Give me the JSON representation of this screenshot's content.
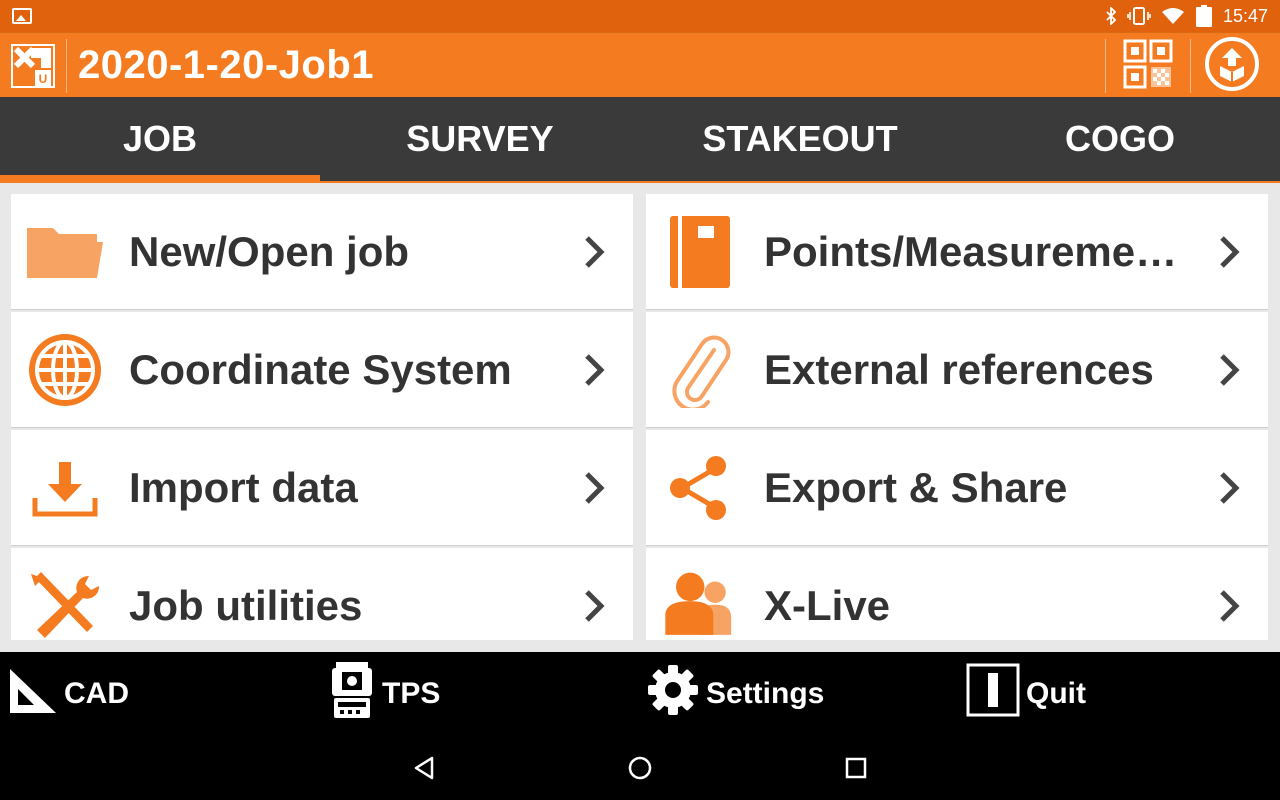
{
  "status_bar": {
    "time": "15:47",
    "icons": [
      "image-notification-icon",
      "bluetooth-icon",
      "vibrate-icon",
      "wifi-icon",
      "battery-icon"
    ]
  },
  "app_bar": {
    "title": "2020-1-20-Job1",
    "logo": "x-pad-logo",
    "actions": [
      "qr-code-icon",
      "sync-box-icon"
    ],
    "accent_color": "#f47b20"
  },
  "tabs": [
    {
      "label": "JOB",
      "active": true
    },
    {
      "label": "SURVEY",
      "active": false
    },
    {
      "label": "STAKEOUT",
      "active": false
    },
    {
      "label": "COGO",
      "active": false
    }
  ],
  "menu": {
    "left": [
      {
        "label": "New/Open job",
        "icon": "folder-icon"
      },
      {
        "label": "Coordinate System",
        "icon": "globe-icon"
      },
      {
        "label": "Import data",
        "icon": "download-icon"
      },
      {
        "label": "Job utilities",
        "icon": "tools-icon"
      }
    ],
    "right": [
      {
        "label": "Points/Measureme…",
        "icon": "notebook-icon"
      },
      {
        "label": "External references",
        "icon": "paperclip-icon"
      },
      {
        "label": "Export & Share",
        "icon": "share-icon"
      },
      {
        "label": "X-Live",
        "icon": "users-icon"
      }
    ]
  },
  "toolbar": {
    "cad_label": "CAD",
    "tps_label": "TPS",
    "settings_label": "Settings",
    "quit_label": "Quit"
  },
  "nav_bar": {
    "buttons": [
      "back-icon",
      "home-icon",
      "recents-icon"
    ]
  }
}
